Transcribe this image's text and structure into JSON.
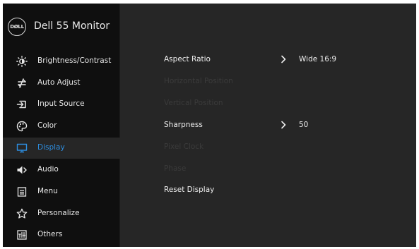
{
  "header": {
    "logo_text": "DØLL",
    "title": "Dell 55 Monitor"
  },
  "sidebar": {
    "items": [
      {
        "label": "Brightness/Contrast",
        "icon": "brightness-icon"
      },
      {
        "label": "Auto Adjust",
        "icon": "auto-adjust-icon"
      },
      {
        "label": "Input Source",
        "icon": "input-source-icon"
      },
      {
        "label": "Color",
        "icon": "color-palette-icon"
      },
      {
        "label": "Display",
        "icon": "display-icon",
        "active": true
      },
      {
        "label": "Audio",
        "icon": "speaker-icon"
      },
      {
        "label": "Menu",
        "icon": "menu-icon"
      },
      {
        "label": "Personalize",
        "icon": "star-icon"
      },
      {
        "label": "Others",
        "icon": "others-icon"
      }
    ]
  },
  "display": {
    "rows": [
      {
        "name": "Aspect Ratio",
        "value": "Wide 16:9",
        "enabled": true
      },
      {
        "name": "Horizontal Position",
        "enabled": false
      },
      {
        "name": "Vertical Position",
        "enabled": false
      },
      {
        "name": "Sharpness",
        "value": "50",
        "enabled": true
      },
      {
        "name": "Pixel Clock",
        "enabled": false
      },
      {
        "name": "Phase",
        "enabled": false
      },
      {
        "name": "Reset Display",
        "enabled": true
      }
    ]
  },
  "colors": {
    "accent": "#2d8ee0",
    "panel": "#262626",
    "sidebar": "#0f0f0f",
    "disabled_text": "#3b3b3b"
  }
}
